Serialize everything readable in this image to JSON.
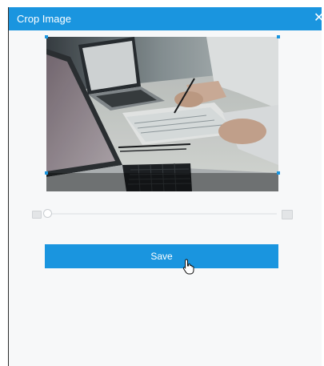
{
  "dialog": {
    "title": "Crop Image",
    "close_icon": "close-icon",
    "close_glyph": "✕"
  },
  "crop": {
    "image_description_icon": "photo-laptops-meeting"
  },
  "zoom": {
    "value_fraction": 0.0,
    "zoom_out_icon": "zoom-out-icon",
    "zoom_in_icon": "zoom-in-icon"
  },
  "actions": {
    "save_label": "Save"
  },
  "colors": {
    "accent": "#1a95df",
    "background": "#f7f8f9"
  }
}
